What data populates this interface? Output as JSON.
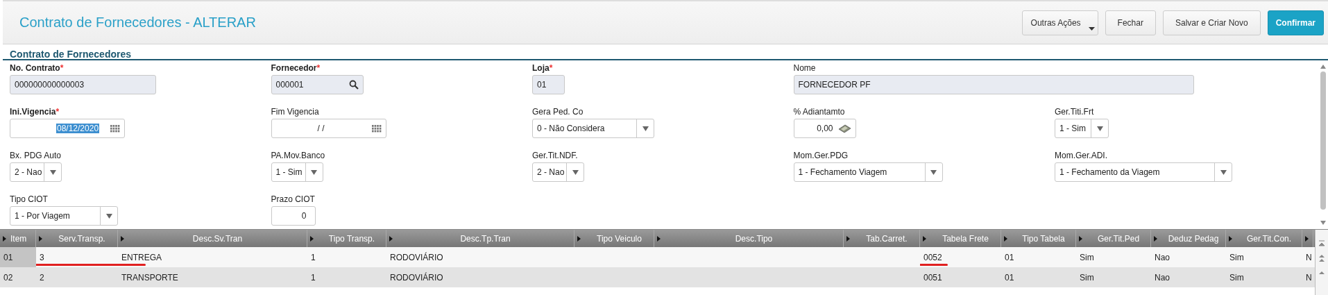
{
  "window": {
    "title": "Contrato de Fornecedores - ALTERAR"
  },
  "actions": [
    {
      "label": "Outras Ações",
      "kind": "menu"
    },
    {
      "label": "Fechar",
      "kind": "plain"
    },
    {
      "label": "Salvar e Criar Novo",
      "kind": "plain"
    },
    {
      "label": "Confirmar",
      "kind": "primary"
    }
  ],
  "section": {
    "title": "Contrato de Fornecedores"
  },
  "form_rows": [
    [
      {
        "label": "No. Contrato",
        "required_mark": "*",
        "kind": "readonly",
        "value": "000000000000003"
      },
      {
        "label": "Fornecedor",
        "required_mark": "*",
        "kind": "lookup",
        "value": "000001"
      },
      {
        "label": "Loja",
        "required_mark": "*",
        "kind": "readonly",
        "value": "01"
      },
      {
        "label": "Nome",
        "kind": "readonly",
        "value": "FORNECEDOR PF"
      }
    ],
    [
      {
        "label": "Ini.Vigencia",
        "required_mark": "*",
        "kind": "date",
        "value": "08/12/2020",
        "selected": true
      },
      {
        "label": "Fim Vigencia",
        "kind": "date",
        "value": "/ /",
        "selected": false
      },
      {
        "label": "Gera Ped. Co",
        "kind": "select",
        "value": "0 - Não Considera"
      },
      {
        "label": "% Adiantamto",
        "kind": "number",
        "value": "0,00"
      },
      {
        "label": "Ger.Titi.Frt",
        "kind": "select",
        "value": "1 - Sim"
      }
    ],
    [
      {
        "label": "Bx. PDG Auto",
        "kind": "select",
        "value": "2 - Nao"
      },
      {
        "label": "PA.Mov.Banco",
        "kind": "select",
        "value": "1 - Sim"
      },
      {
        "label": "Ger.Tit.NDF.",
        "kind": "select",
        "value": "2 - Nao"
      },
      {
        "label": "Mom.Ger.PDG",
        "kind": "select",
        "value": "1 - Fechamento Viagem"
      },
      {
        "label": "Mom.Ger.ADI.",
        "kind": "select",
        "value": "1 -  Fechamento da Viagem"
      }
    ],
    [
      {
        "label": "Tipo CIOT",
        "kind": "select",
        "value": "1 - Por Viagem"
      },
      {
        "label": "Prazo CIOT",
        "kind": "number",
        "value": "0"
      }
    ]
  ],
  "table": {
    "columns": [
      {
        "label": "Item"
      },
      {
        "label": "Serv.Transp."
      },
      {
        "label": "Desc.Sv.Tran"
      },
      {
        "label": "Tipo Transp."
      },
      {
        "label": "Desc.Tp.Tran"
      },
      {
        "label": "Tipo Veiculo"
      },
      {
        "label": "Desc.Tipo"
      },
      {
        "label": "Tab.Carret."
      },
      {
        "label": "Tabela Frete"
      },
      {
        "label": "Tipo Tabela"
      },
      {
        "label": "Ger.Tit.Ped"
      },
      {
        "label": "Deduz Pedag"
      },
      {
        "label": "Ger.Tit.Con."
      },
      {}
    ],
    "rows": [
      {
        "selected": true,
        "cells": [
          {
            "text": "01",
            "underlined": false
          },
          {
            "text": "3",
            "underlined": true
          },
          {
            "text": "ENTREGA",
            "underlined": true
          },
          {
            "text": "1",
            "underlined": false
          },
          {
            "text": "RODOVIÁRIO",
            "underlined": false
          },
          {
            "underlined": false
          },
          {
            "underlined": false
          },
          {
            "underlined": false
          },
          {
            "text": "0052",
            "underlined": true
          },
          {
            "text": "01",
            "underlined": false
          },
          {
            "text": "Sim",
            "underlined": false
          },
          {
            "text": "Nao",
            "underlined": false
          },
          {
            "text": "Sim",
            "underlined": false
          },
          {
            "text": "N",
            "underlined": false
          }
        ]
      },
      {
        "selected": false,
        "cells": [
          {
            "text": "02",
            "underlined": false
          },
          {
            "text": "2",
            "underlined": false
          },
          {
            "text": "TRANSPORTE",
            "underlined": false
          },
          {
            "text": "1",
            "underlined": false
          },
          {
            "text": "RODOVIÁRIO",
            "underlined": false
          },
          {
            "underlined": false
          },
          {
            "underlined": false
          },
          {
            "underlined": false
          },
          {
            "text": "0051",
            "underlined": false
          },
          {
            "text": "01",
            "underlined": false
          },
          {
            "text": "Sim",
            "underlined": false
          },
          {
            "text": "Nao",
            "underlined": false
          },
          {
            "text": "Sim",
            "underlined": false
          },
          {
            "text": "N",
            "underlined": false
          }
        ]
      }
    ]
  }
}
